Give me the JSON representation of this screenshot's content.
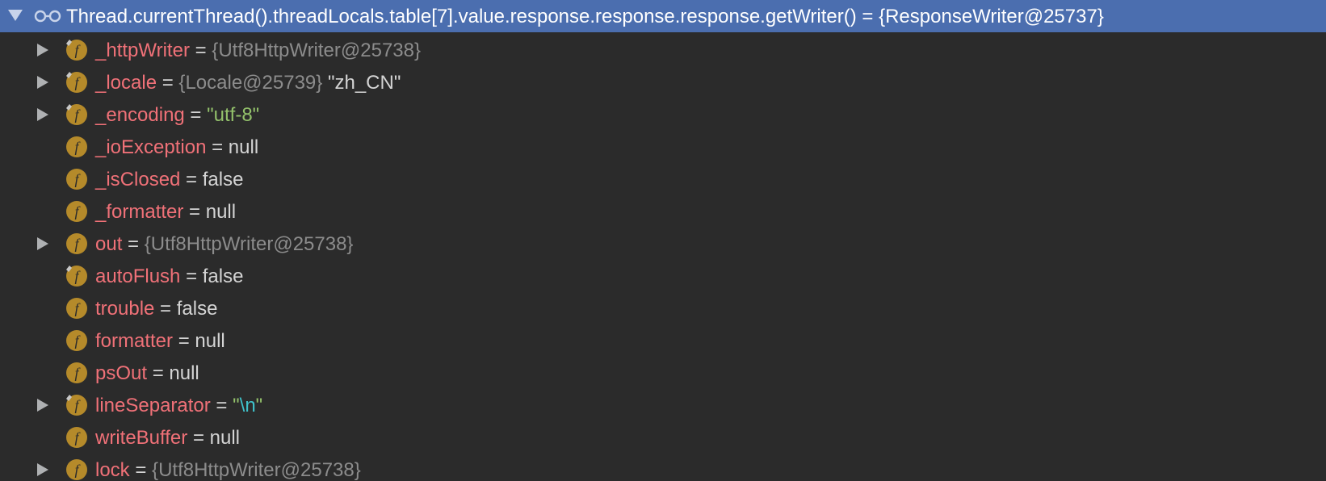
{
  "header": {
    "expression": "Thread.currentThread().threadLocals.table[7].value.response.response.response.getWriter() = {ResponseWriter@25737}"
  },
  "rows": [
    {
      "expandable": true,
      "final": true,
      "name": "_httpWriter",
      "eq": " = ",
      "value_ref": "{Utf8HttpWriter@25738}",
      "value_str": "",
      "value_plain": ""
    },
    {
      "expandable": true,
      "final": true,
      "name": "_locale",
      "eq": " = ",
      "value_ref": "{Locale@25739}",
      "value_str": "",
      "value_plain": " \"zh_CN\""
    },
    {
      "expandable": true,
      "final": true,
      "name": "_encoding",
      "eq": " = ",
      "value_ref": "",
      "value_str": "\"utf-8\"",
      "value_plain": ""
    },
    {
      "expandable": false,
      "final": false,
      "name": "_ioException",
      "eq": " = ",
      "value_ref": "",
      "value_str": "",
      "value_plain": "null"
    },
    {
      "expandable": false,
      "final": false,
      "name": "_isClosed",
      "eq": " = ",
      "value_ref": "",
      "value_str": "",
      "value_plain": "false"
    },
    {
      "expandable": false,
      "final": false,
      "name": "_formatter",
      "eq": " = ",
      "value_ref": "",
      "value_str": "",
      "value_plain": "null"
    },
    {
      "expandable": true,
      "final": false,
      "name": "out",
      "eq": " = ",
      "value_ref": "{Utf8HttpWriter@25738}",
      "value_str": "",
      "value_plain": ""
    },
    {
      "expandable": false,
      "final": true,
      "name": "autoFlush",
      "eq": " = ",
      "value_ref": "",
      "value_str": "",
      "value_plain": "false"
    },
    {
      "expandable": false,
      "final": false,
      "name": "trouble",
      "eq": " = ",
      "value_ref": "",
      "value_str": "",
      "value_plain": "false"
    },
    {
      "expandable": false,
      "final": false,
      "name": "formatter",
      "eq": " = ",
      "value_ref": "",
      "value_str": "",
      "value_plain": "null"
    },
    {
      "expandable": false,
      "final": false,
      "name": "psOut",
      "eq": " = ",
      "value_ref": "",
      "value_str": "",
      "value_plain": "null"
    },
    {
      "expandable": true,
      "final": true,
      "name": "lineSeparator",
      "eq": " = ",
      "value_ref": "",
      "value_str": "\"",
      "value_esc": "\\n",
      "value_str_end": "\"",
      "value_plain": ""
    },
    {
      "expandable": false,
      "final": false,
      "name": "writeBuffer",
      "eq": " = ",
      "value_ref": "",
      "value_str": "",
      "value_plain": "null"
    },
    {
      "expandable": true,
      "final": false,
      "name": "lock",
      "eq": " = ",
      "value_ref": "{Utf8HttpWriter@25738}",
      "value_str": "",
      "value_plain": ""
    }
  ],
  "icons": {
    "field_icon": "field-f-icon",
    "final_marker": "lock-marker-icon",
    "watch": "glasses-icon"
  },
  "colors": {
    "background": "#2B2B2B",
    "selected_row": "#4B6EAF",
    "field_name": "#F07178",
    "reference": "#8C8C8C",
    "string": "#93C16B",
    "escape": "#3FC1C9",
    "plain": "#D4D4D4",
    "field_icon": "#B58A2A"
  }
}
